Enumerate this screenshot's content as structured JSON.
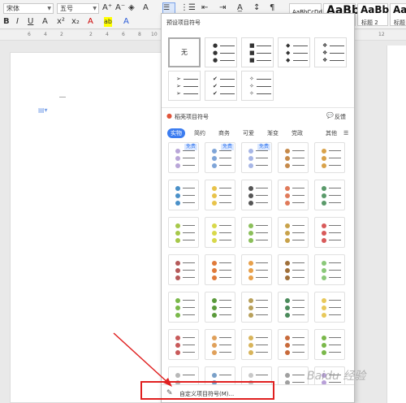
{
  "toolbar": {
    "font_name": "宋体",
    "font_size": "五号",
    "buttons_row1": [
      "A⁺",
      "A⁻",
      "◈",
      "A"
    ],
    "buttons_row2": [
      "B",
      "I",
      "U",
      "A",
      "x²",
      "x₂",
      "A",
      "ab",
      "A"
    ],
    "styles": [
      {
        "preview": "AaBbCcDd",
        "label": ""
      },
      {
        "preview": "AaBb",
        "label": ""
      },
      {
        "preview": "AaBb(",
        "label": "标题 2"
      },
      {
        "preview": "AaBb",
        "label": "标题"
      }
    ]
  },
  "ruler": [
    "6",
    "4",
    "2",
    "2",
    "4",
    "6",
    "8",
    "10",
    "12"
  ],
  "panel": {
    "preset_title": "预设项目符号",
    "none_label": "无",
    "fancy_title": "稻壳项目符号",
    "feedback": "反馈",
    "tabs": [
      "实物",
      "简约",
      "商务",
      "可爱",
      "渐变",
      "党政",
      "其他"
    ],
    "free_badge": "免费",
    "custom_label": "自定义项目符号(M)..."
  },
  "watermark": "Baidu 经验",
  "colors": {
    "accent": "#3b7cf0",
    "highlight": "#e02020"
  }
}
